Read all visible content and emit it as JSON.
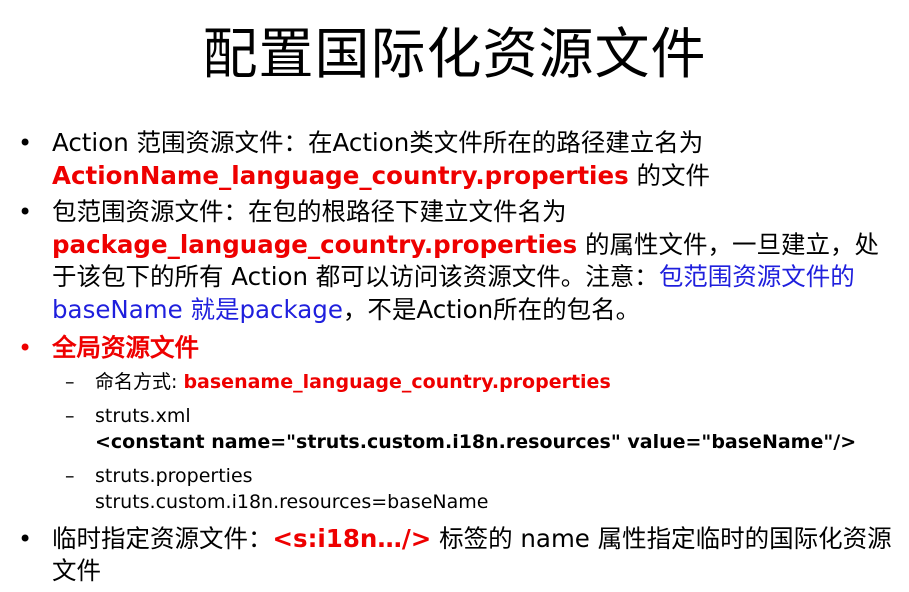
{
  "slide": {
    "title": "配置国际化资源文件",
    "bullet_glyph": "•",
    "dash_glyph": "–",
    "item1": {
      "text1": "Action 范围资源文件：在Action类文件所在的路径建立名为",
      "highlight": "ActionName_language_country.properties",
      "text2": " 的文件"
    },
    "item2": {
      "text1": "包范围资源文件：在包的根路径下建立文件名为",
      "highlight": "package_language_country.properties",
      "text2": " 的属性文件，一旦建立，处于该包下的所有 Action 都可以访问该资源文件。注意：",
      "note": "包范围资源文件的 baseName 就是package",
      "text3": "，不是Action所在的包名。"
    },
    "item3": {
      "heading": "全局资源文件",
      "sub1": {
        "label": "命名方式: ",
        "value": "basename_language_country.properties"
      },
      "sub2": {
        "label": "struts.xml",
        "code": "<constant name=\"struts.custom.i18n.resources\"  value=\"baseName\"/>"
      },
      "sub3": {
        "label": "struts.properties",
        "code": "struts.custom.i18n.resources=baseName"
      }
    },
    "item4": {
      "text1": "临时指定资源文件：",
      "highlight": "<s:i18n…/>",
      "text2": " 标签的 name 属性指定临时的国际化资源文件"
    }
  }
}
